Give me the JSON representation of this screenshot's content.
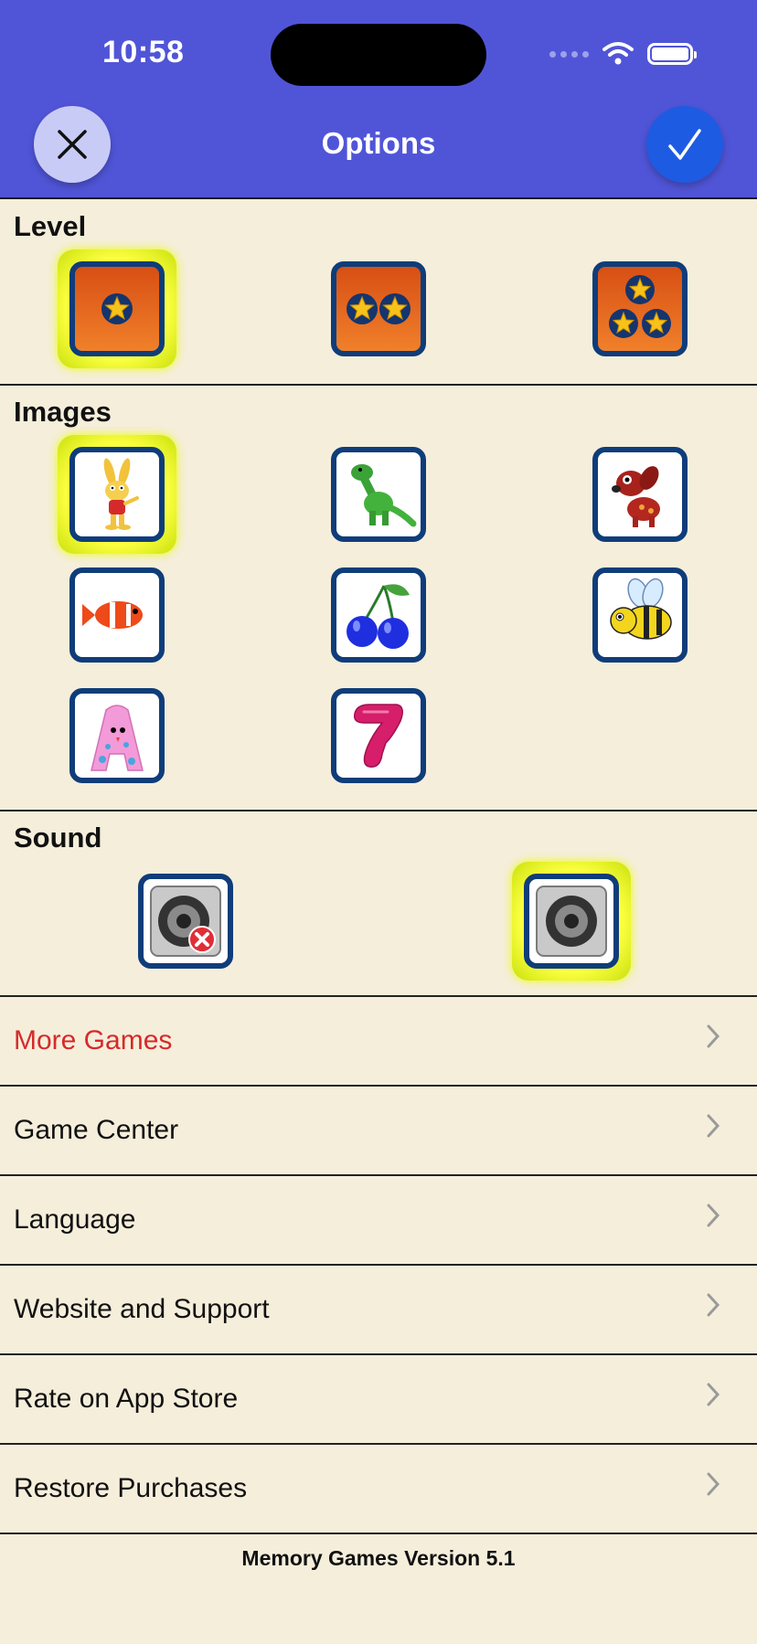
{
  "status_bar": {
    "time": "10:58"
  },
  "nav": {
    "title": "Options",
    "close_icon": "close-icon",
    "confirm_icon": "checkmark-icon"
  },
  "level": {
    "title": "Level",
    "options": [
      {
        "stars": 1,
        "selected": true
      },
      {
        "stars": 2,
        "selected": false
      },
      {
        "stars": 3,
        "selected": false
      }
    ]
  },
  "images": {
    "title": "Images",
    "options": [
      {
        "icon": "rabbit-icon",
        "selected": true
      },
      {
        "icon": "dinosaur-icon",
        "selected": false
      },
      {
        "icon": "dog-icon",
        "selected": false
      },
      {
        "icon": "clownfish-icon",
        "selected": false
      },
      {
        "icon": "cherries-icon",
        "selected": false
      },
      {
        "icon": "bee-icon",
        "selected": false
      },
      {
        "icon": "letter-a-monster-icon",
        "selected": false
      },
      {
        "icon": "number-seven-icon",
        "selected": false
      }
    ]
  },
  "sound": {
    "title": "Sound",
    "options": [
      {
        "icon": "speaker-muted-icon",
        "selected": false
      },
      {
        "icon": "speaker-on-icon",
        "selected": true
      }
    ]
  },
  "menu": [
    {
      "label": "More Games",
      "color": "#d62a2a"
    },
    {
      "label": "Game Center",
      "color": "#111111"
    },
    {
      "label": "Language",
      "color": "#111111"
    },
    {
      "label": "Website and Support",
      "color": "#111111"
    },
    {
      "label": "Rate on App Store",
      "color": "#111111"
    },
    {
      "label": "Restore Purchases",
      "color": "#111111"
    }
  ],
  "footer": {
    "version": "Memory Games Version 5.1"
  },
  "colors": {
    "header": "#5055d8",
    "background": "#f5eedb",
    "accent_red": "#d62a2a",
    "selection_glow": "#eaff00"
  }
}
